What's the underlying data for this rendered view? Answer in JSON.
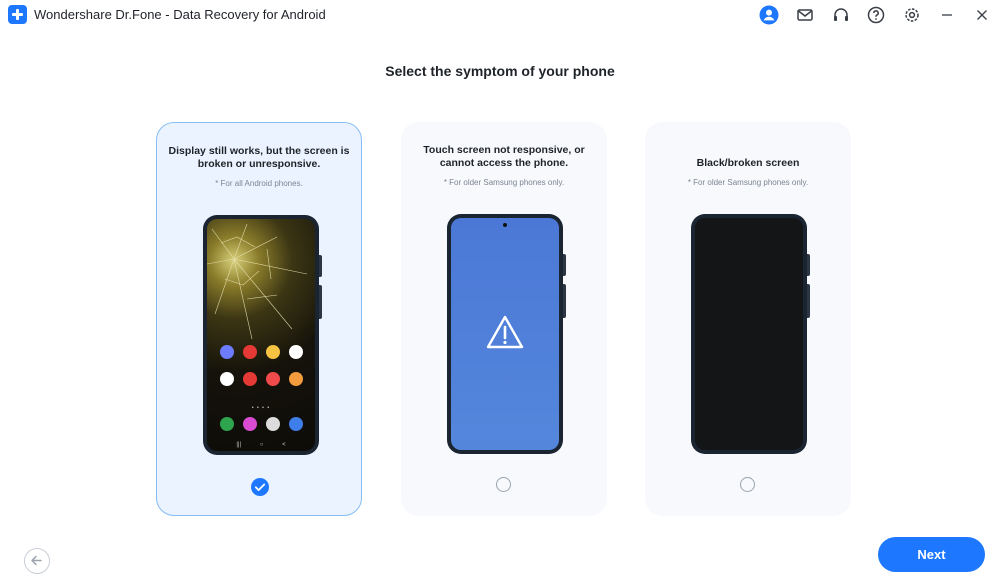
{
  "window": {
    "title": "Wondershare Dr.Fone - Data Recovery for Android",
    "icons": [
      "user-icon",
      "mail-icon",
      "headset-icon",
      "help-icon",
      "settings-icon",
      "minimize-icon",
      "close-icon"
    ]
  },
  "main": {
    "heading": "Select the symptom of your phone",
    "options": [
      {
        "title": "Display still works, but the screen is broken or unresponsive.",
        "note": "* For all Android phones.",
        "selected": true,
        "illustration": "cracked-screen-phone"
      },
      {
        "title": "Touch screen not responsive, or cannot access the phone.",
        "note": "* For older Samsung phones only.",
        "selected": false,
        "illustration": "warning-screen-phone"
      },
      {
        "title": "Black/broken screen",
        "note": "* For older Samsung phones only.",
        "selected": false,
        "illustration": "black-screen-phone"
      }
    ]
  },
  "footer": {
    "back_icon": "arrow-left-icon",
    "next_label": "Next"
  },
  "colors": {
    "accent": "#1e78ff",
    "selected_card_bg": "#eaf3ff",
    "selected_card_border": "#86bdf4",
    "card_bg": "#f7f9fc"
  }
}
